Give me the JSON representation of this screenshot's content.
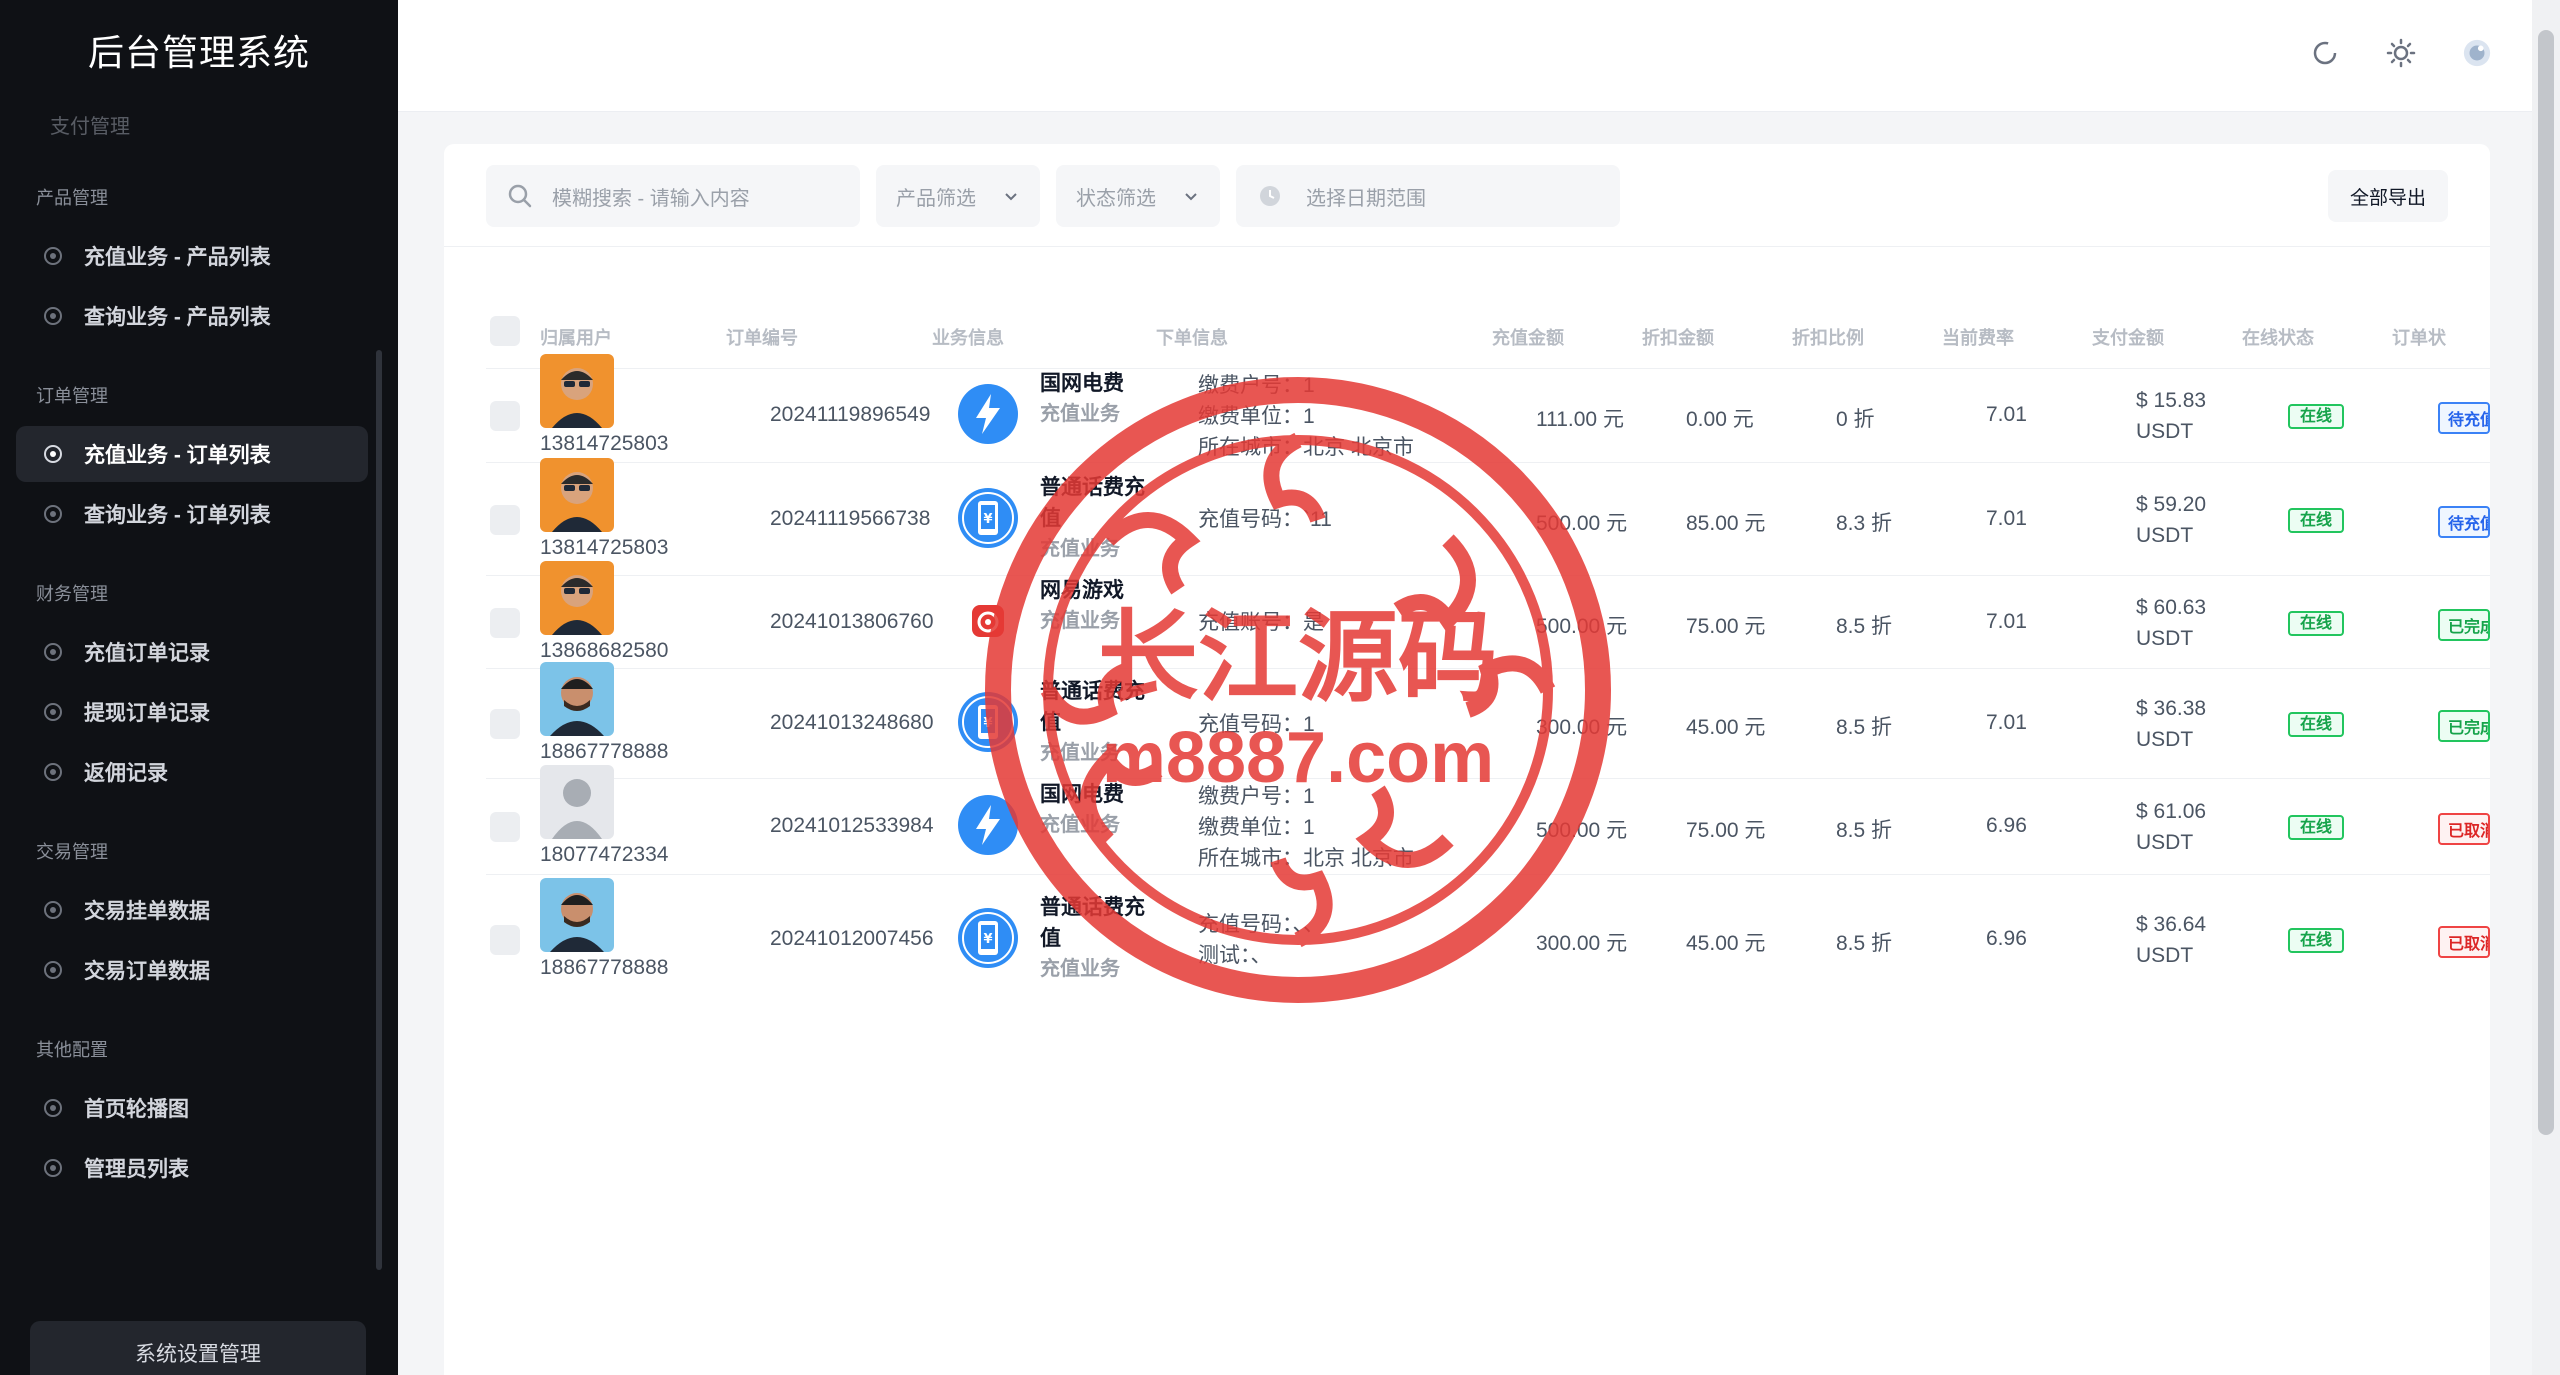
{
  "app": {
    "title": "后台管理系统"
  },
  "sidebar": {
    "cut_item": "支付管理",
    "groups": [
      {
        "label": "产品管理",
        "items": [
          "充值业务 - 产品列表",
          "查询业务 - 产品列表"
        ]
      },
      {
        "label": "订单管理",
        "items": [
          "充值业务 - 订单列表",
          "查询业务 - 订单列表"
        ]
      },
      {
        "label": "财务管理",
        "items": [
          "充值订单记录",
          "提现订单记录",
          "返佣记录"
        ]
      },
      {
        "label": "交易管理",
        "items": [
          "交易挂单数据",
          "交易订单数据"
        ]
      },
      {
        "label": "其他配置",
        "items": [
          "首页轮播图",
          "管理员列表"
        ]
      }
    ],
    "active_item": "充值业务 - 订单列表",
    "bottom_button": "系统设置管理"
  },
  "topbar": {
    "icons": [
      "refresh-icon",
      "sun-icon",
      "admin-avatar-icon"
    ]
  },
  "filters": {
    "search_placeholder": "模糊搜索 - 请输入内容",
    "product_filter": "产品筛选",
    "status_filter": "状态筛选",
    "date_placeholder": "选择日期范围",
    "export_label": "全部导出"
  },
  "table": {
    "headers": [
      "归属用户",
      "订单编号",
      "业务信息",
      "下单信息",
      "充值金额",
      "折扣金额",
      "折扣比例",
      "当前费率",
      "支付金额",
      "在线状态",
      "订单状"
    ],
    "rows": [
      {
        "user": "13814725803",
        "avatar": "orange",
        "order_no": "20241119896549",
        "biz_icon": "lightning",
        "biz_title": "国网电费",
        "biz_sub": "充值业务",
        "order_info": [
          "缴费户号：1",
          "缴费单位：1",
          "所在城市：北京 北京市"
        ],
        "amount": "111.00 元",
        "discount": "0.00 元",
        "ratio": "0 折",
        "rate": "7.01",
        "pay": "$ 15.83",
        "pay_unit": "USDT",
        "online": "在线",
        "status": "待充值",
        "status_type": "pending"
      },
      {
        "user": "13814725803",
        "avatar": "orange",
        "order_no": "20241119566738",
        "biz_icon": "phone",
        "biz_title": "普通话费充值",
        "biz_sub": "充值业务",
        "order_info": [
          "充值号码：`11"
        ],
        "amount": "500.00 元",
        "discount": "85.00 元",
        "ratio": "8.3 折",
        "rate": "7.01",
        "pay": "$ 59.20",
        "pay_unit": "USDT",
        "online": "在线",
        "status": "待充值",
        "status_type": "pending"
      },
      {
        "user": "13868682580",
        "avatar": "orange",
        "order_no": "20241013806760",
        "biz_icon": "game",
        "biz_title": "网易游戏",
        "biz_sub": "充值业务",
        "order_info": [
          "充值账号：是"
        ],
        "amount": "500.00 元",
        "discount": "75.00 元",
        "ratio": "8.5 折",
        "rate": "7.01",
        "pay": "$ 60.63",
        "pay_unit": "USDT",
        "online": "在线",
        "status": "已完成",
        "status_type": "done"
      },
      {
        "user": "18867778888",
        "avatar": "blue",
        "order_no": "20241013248680",
        "biz_icon": "phone",
        "biz_title": "普通话费充值",
        "biz_sub": "充值业务",
        "order_info": [
          "充值号码：1"
        ],
        "amount": "300.00 元",
        "discount": "45.00 元",
        "ratio": "8.5 折",
        "rate": "7.01",
        "pay": "$ 36.38",
        "pay_unit": "USDT",
        "online": "在线",
        "status": "已完成",
        "status_type": "done"
      },
      {
        "user": "18077472334",
        "avatar": "gray",
        "order_no": "20241012533984",
        "biz_icon": "lightning",
        "biz_title": "国网电费",
        "biz_sub": "充值业务",
        "order_info": [
          "缴费户号：1",
          "缴费单位：1",
          "所在城市：北京 北京市"
        ],
        "amount": "500.00 元",
        "discount": "75.00 元",
        "ratio": "8.5 折",
        "rate": "6.96",
        "pay": "$ 61.06",
        "pay_unit": "USDT",
        "online": "在线",
        "status": "已取消",
        "status_type": "cancel"
      },
      {
        "user": "18867778888",
        "avatar": "blue",
        "order_no": "20241012007456",
        "biz_icon": "phone",
        "biz_title": "普通话费充值",
        "biz_sub": "充值业务",
        "order_info": [
          "充值号码：、、",
          "测试：、"
        ],
        "amount": "300.00 元",
        "discount": "45.00 元",
        "ratio": "8.5 折",
        "rate": "6.96",
        "pay": "$ 36.64",
        "pay_unit": "USDT",
        "online": "在线",
        "status": "已取消",
        "status_type": "cancel"
      }
    ]
  },
  "watermark": {
    "line1": "长江源码",
    "line2": "m8887.com"
  },
  "colors": {
    "sidebar_bg": "#0f1115",
    "online_green": "#22c55e",
    "pending_blue": "#3b82f6",
    "cancel_red": "#ef4444",
    "lightning_blue": "#2f8df5",
    "game_red": "#e53935"
  }
}
